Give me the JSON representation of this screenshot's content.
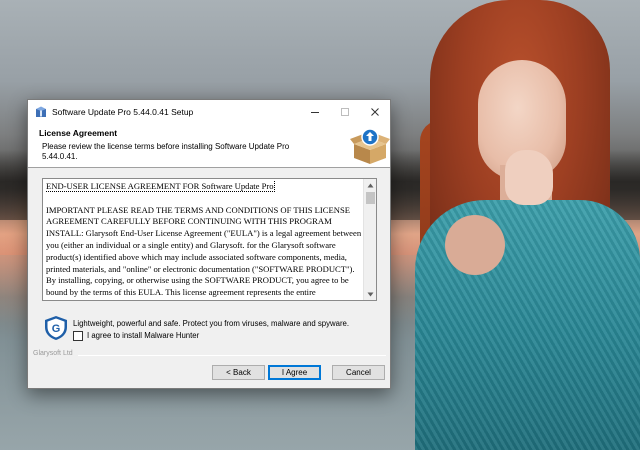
{
  "window": {
    "title": "Software Update Pro 5.44.0.41 Setup",
    "controls": {
      "minimize": "—",
      "maximize": "☐",
      "close": "✕"
    }
  },
  "header": {
    "title": "License Agreement",
    "subtitle": "Please review the license terms before installing Software Update Pro 5.44.0.41.",
    "icon": "software-box-icon"
  },
  "license": {
    "first_line": "END-USER LICENSE AGREEMENT FOR Software Update Pro",
    "body": "IMPORTANT PLEASE READ THE TERMS AND CONDITIONS OF THIS LICENSE AGREEMENT CAREFULLY BEFORE CONTINUING WITH THIS PROGRAM INSTALL: Glarysoft End-User License Agreement (\"EULA\") is a legal agreement between you (either an individual or a single entity) and Glarysoft. for the Glarysoft software product(s) identified above which may include associated software components, media, printed materials, and \"online\" or electronic documentation (\"SOFTWARE PRODUCT\"). By installing, copying, or otherwise using the SOFTWARE PRODUCT, you agree to be bound by the terms of this EULA. This license agreement represents the entire"
  },
  "promo": {
    "text": "Lightweight, powerful and safe. Protect you from viruses, malware and spyware.",
    "checkbox_label": "I agree to install Malware Hunter",
    "checked": false
  },
  "footer": {
    "brand": "Glarysoft Ltd"
  },
  "buttons": {
    "back": "< Back",
    "agree": "I Agree",
    "cancel": "Cancel"
  },
  "colors": {
    "accent": "#0078d7",
    "window_bg": "#f0f0f0",
    "dress": "#2a8896"
  }
}
